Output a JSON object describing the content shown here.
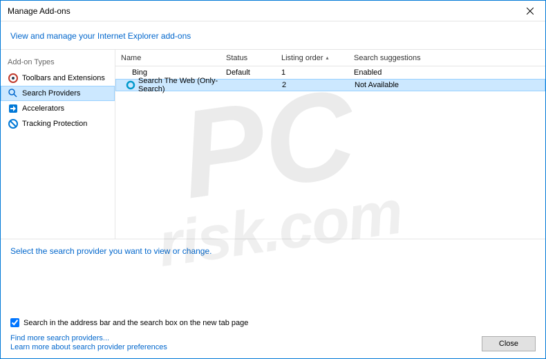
{
  "titlebar": {
    "title": "Manage Add-ons"
  },
  "header": {
    "link": "View and manage your Internet Explorer add-ons"
  },
  "sidebar": {
    "header": "Add-on Types",
    "items": [
      {
        "label": "Toolbars and Extensions",
        "icon": "toolbar"
      },
      {
        "label": "Search Providers",
        "icon": "search"
      },
      {
        "label": "Accelerators",
        "icon": "accel"
      },
      {
        "label": "Tracking Protection",
        "icon": "protect"
      }
    ]
  },
  "table": {
    "headers": {
      "name": "Name",
      "status": "Status",
      "listing": "Listing order",
      "search": "Search suggestions"
    },
    "rows": [
      {
        "name": "Bing",
        "status": "Default",
        "listing": "1",
        "search": "Enabled",
        "icon": ""
      },
      {
        "name": "Search The Web (Only-Search)",
        "status": "",
        "listing": "2",
        "search": "Not Available",
        "icon": "ring"
      }
    ]
  },
  "bottom": {
    "instruction": "Select the search provider you want to view or change.",
    "checkbox": "Search in the address bar and the search box on the new tab page",
    "link1": "Find more search providers...",
    "link2": "Learn more about search provider preferences",
    "closeButton": "Close"
  },
  "watermark": {
    "top": "PC",
    "bottom": "risk.com"
  }
}
